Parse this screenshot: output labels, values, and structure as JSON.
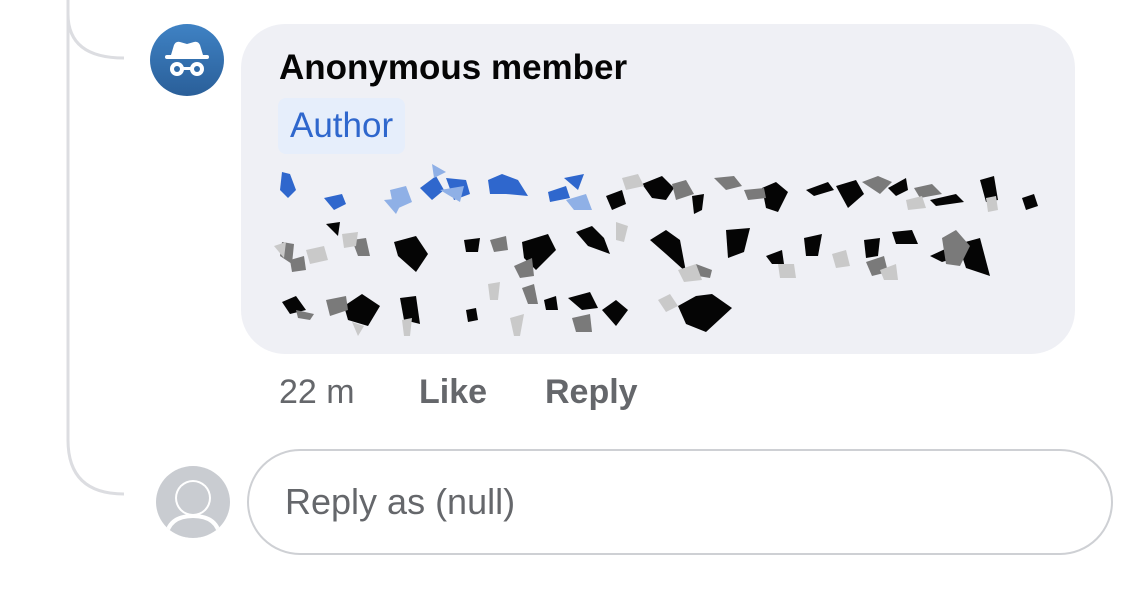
{
  "comment": {
    "author": "Anonymous member",
    "badge": "Author",
    "actions": {
      "time": "22 m",
      "like": "Like",
      "reply": "Reply"
    }
  },
  "composer": {
    "placeholder": "Reply as (null)"
  },
  "icons": {
    "anonymous_avatar": "incognito-icon",
    "user_avatar": "default-avatar-icon"
  },
  "colors": {
    "bubble": "#eff0f5",
    "badge_text": "#2f67cd",
    "avatar_blue": "#3f82c4",
    "meta_text": "#65676b"
  }
}
